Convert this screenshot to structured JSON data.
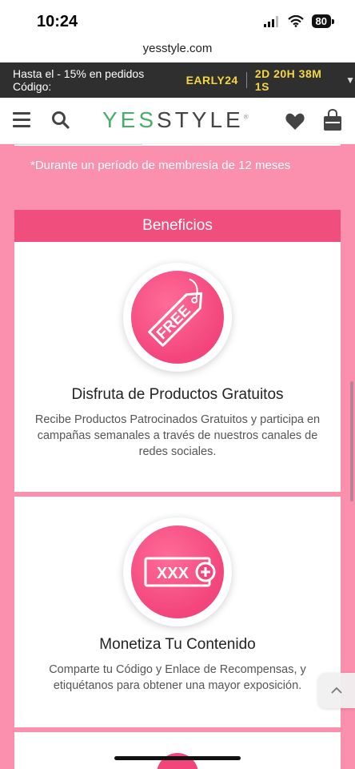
{
  "status": {
    "time": "10:24",
    "battery": "80"
  },
  "url": "yesstyle.com",
  "promo": {
    "text": "Hasta el - 15% en pedidos Código:",
    "code": "EARLY24",
    "timer": "2D 20H 38M 1S"
  },
  "header": {
    "logo_green": "YES",
    "logo_dark": "STYLE",
    "logo_mark": "®"
  },
  "content": {
    "footnote": "*Durante un período de membresía de 12 meses",
    "banner": "Beneficios",
    "benefits": [
      {
        "badge": "FREE",
        "title": "Disfruta de Productos Gratuitos",
        "description": "Recibe Productos Patrocinados Gratuitos y participa en campañas semanales a través de nuestros canales de redes sociales."
      },
      {
        "badge": "XXX",
        "title": "Monetiza Tu Contenido",
        "description": "Comparte tu Código y Enlace de Recompensas, y etiquétanos para obtener una mayor exposición."
      }
    ]
  },
  "colors": {
    "accent": "#f04f7e",
    "background": "#fb8fae",
    "promo_bg": "#2f2f2f",
    "promo_highlight": "#f5d742",
    "logo_green": "#4aae6b"
  }
}
